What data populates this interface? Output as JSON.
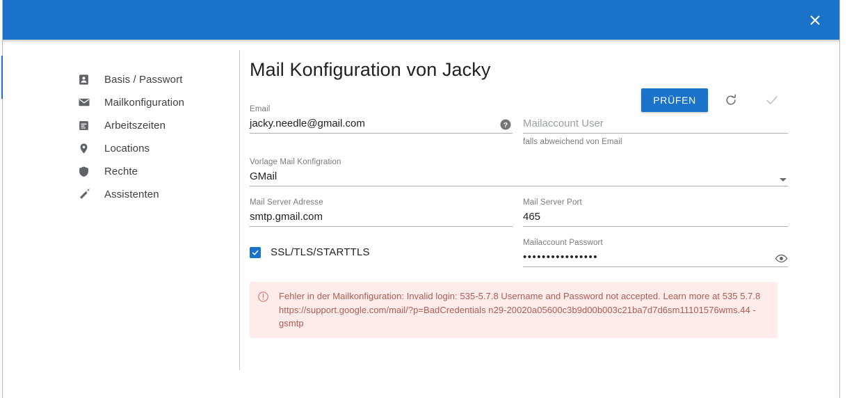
{
  "window": {
    "close_label": "close-icon",
    "accent_color": "#1a73c8"
  },
  "sidebar": {
    "items": [
      {
        "label": "Basis / Passwort",
        "icon": "person-badge-icon"
      },
      {
        "label": "Mailkonfiguration",
        "icon": "envelope-icon"
      },
      {
        "label": "Arbeitszeiten",
        "icon": "timesheet-icon"
      },
      {
        "label": "Locations",
        "icon": "map-pin-icon"
      },
      {
        "label": "Rechte",
        "icon": "shield-icon"
      },
      {
        "label": "Assistenten",
        "icon": "magic-wand-icon"
      }
    ]
  },
  "content": {
    "title": "Mail Konfiguration von Jacky",
    "fields": {
      "email": {
        "label": "Email",
        "value": "jacky.needle@gmail.com",
        "help_icon": "help-icon"
      },
      "mailaccount_user": {
        "label": "",
        "placeholder": "Mailaccount User",
        "value": "",
        "hint": "falls abweichend von Email"
      },
      "vorlage": {
        "label": "Vorlage Mail Konfigration",
        "value": "GMail"
      },
      "server_address": {
        "label": "Mail Server Adresse",
        "value": "smtp.gmail.com"
      },
      "server_port": {
        "label": "Mail Server Port",
        "value": "465"
      },
      "password": {
        "label": "Mailaccount Passwort",
        "value": "••••••••••••••••",
        "reveal_icon": "eye-icon"
      }
    },
    "checkbox": {
      "label": "SSL/TLS/STARTTLS",
      "checked": true
    },
    "error": {
      "icon": "error-circle-icon",
      "color": "#b05b52",
      "background": "#fdecea",
      "line1": "Fehler in der Mailkonfiguration: Invalid login: 535-5.7.8 Username and Password not accepted. Learn more at 535 5.7.8",
      "line2": "https://support.google.com/mail/?p=BadCredentials n29-20020a05600c3b9d00b003c21ba7d7d6sm11101576wms.44 - gsmtp"
    },
    "footer": {
      "check_button": "PRÜFEN",
      "reload_icon": "reload-icon",
      "confirm_icon": "checkmark-icon"
    }
  }
}
